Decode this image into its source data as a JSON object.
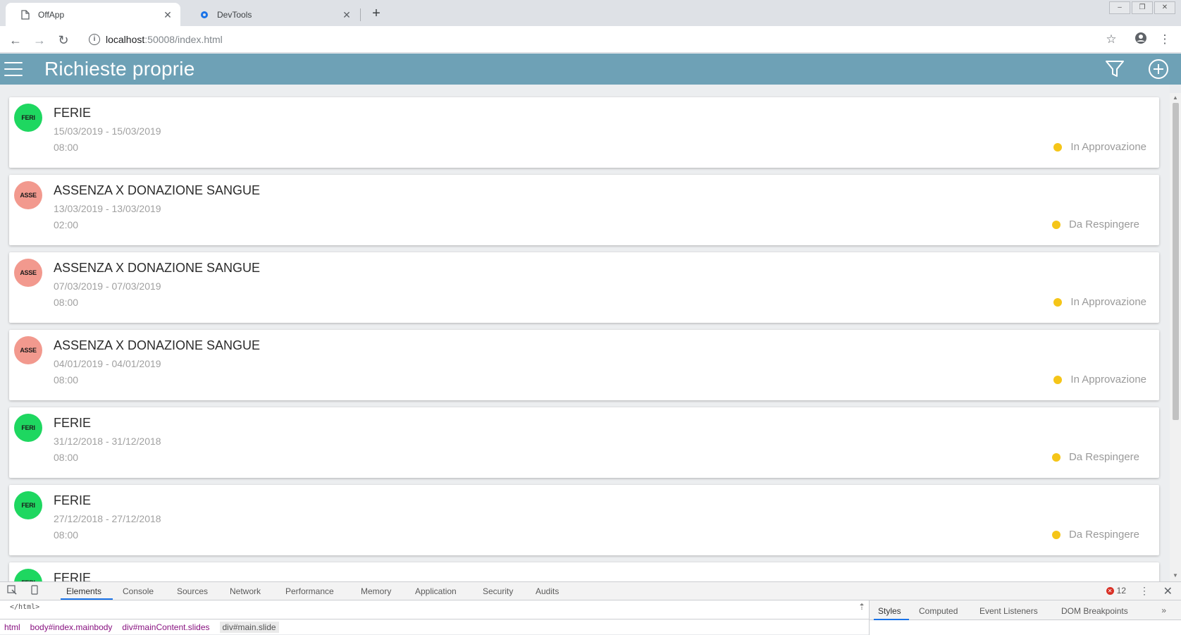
{
  "browser": {
    "tabs": [
      {
        "title": "OffApp",
        "active": true,
        "icon": "page-icon"
      },
      {
        "title": "DevTools",
        "active": false,
        "icon": "gear-icon"
      }
    ],
    "new_tab_label": "+",
    "url_host": "localhost",
    "url_rest": ":50008/index.html"
  },
  "app": {
    "title": "Richieste proprie",
    "filter_icon": "filter-icon",
    "add_icon": "add-circle-icon",
    "menu_icon": "menu-icon",
    "accent": "#6ea1b6"
  },
  "requests": [
    {
      "avatar": "FERI",
      "avatar_color": "#1ed760",
      "title": "FERIE",
      "dates": "15/03/2019 - 15/03/2019",
      "hours": "08:00",
      "status": "In Approvazione",
      "status_color": "#f5c518"
    },
    {
      "avatar": "ASSE",
      "avatar_color": "#f2998e",
      "title": "ASSENZA X DONAZIONE SANGUE",
      "dates": "13/03/2019 - 13/03/2019",
      "hours": "02:00",
      "status": "Da Respingere",
      "status_color": "#f5c518"
    },
    {
      "avatar": "ASSE",
      "avatar_color": "#f2998e",
      "title": "ASSENZA X DONAZIONE SANGUE",
      "dates": "07/03/2019 - 07/03/2019",
      "hours": "08:00",
      "status": "In Approvazione",
      "status_color": "#f5c518"
    },
    {
      "avatar": "ASSE",
      "avatar_color": "#f2998e",
      "title": "ASSENZA X DONAZIONE SANGUE",
      "dates": "04/01/2019 - 04/01/2019",
      "hours": "08:00",
      "status": "In Approvazione",
      "status_color": "#f5c518"
    },
    {
      "avatar": "FERI",
      "avatar_color": "#1ed760",
      "title": "FERIE",
      "dates": "31/12/2018 - 31/12/2018",
      "hours": "08:00",
      "status": "Da Respingere",
      "status_color": "#f5c518"
    },
    {
      "avatar": "FERI",
      "avatar_color": "#1ed760",
      "title": "FERIE",
      "dates": "27/12/2018 - 27/12/2018",
      "hours": "08:00",
      "status": "Da Respingere",
      "status_color": "#f5c518"
    },
    {
      "avatar": "FERI",
      "avatar_color": "#1ed760",
      "title": "FERIE",
      "dates": "",
      "hours": "",
      "status": "",
      "status_color": "#f5c518"
    }
  ],
  "devtools": {
    "tabs": [
      "Elements",
      "Console",
      "Sources",
      "Network",
      "Performance",
      "Memory",
      "Application",
      "Security",
      "Audits"
    ],
    "active_tab": "Elements",
    "error_count": "12",
    "code_line": "</html>",
    "breadcrumbs": [
      "html",
      "body#index.mainbody",
      "div#mainContent.slides",
      "div#main.slide"
    ],
    "side_tabs": [
      "Styles",
      "Computed",
      "Event Listeners",
      "DOM Breakpoints"
    ],
    "side_more": "»"
  }
}
